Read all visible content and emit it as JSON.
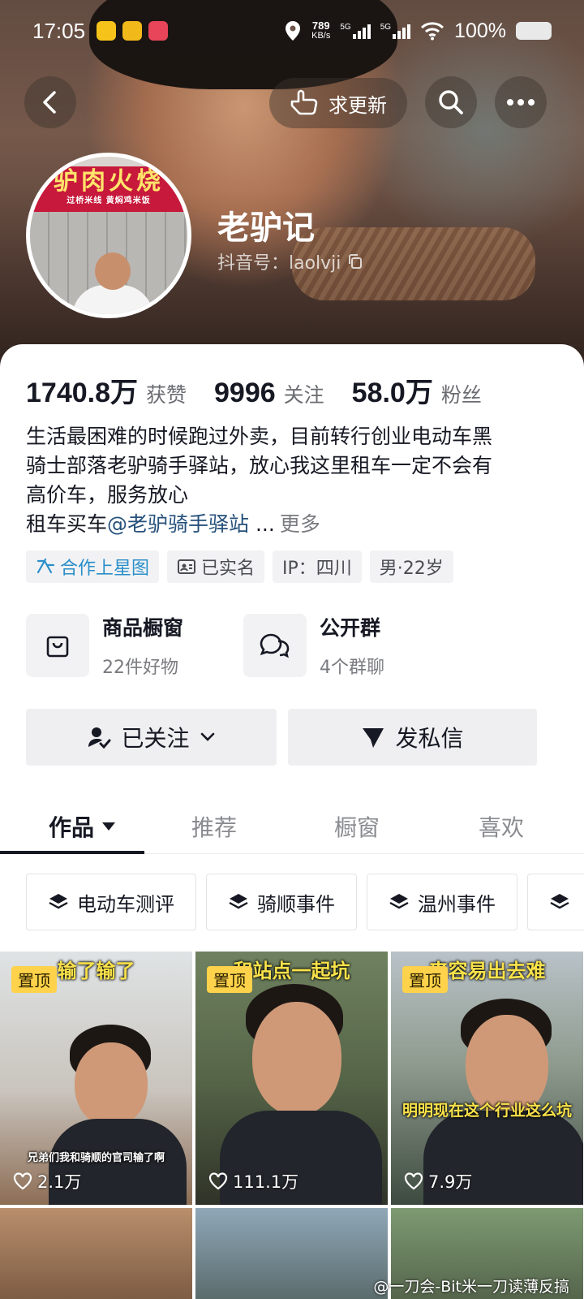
{
  "status_bar": {
    "time": "17:05",
    "net_speed_value": "789",
    "net_speed_unit": "KB/s",
    "sim1": "5G",
    "sim2": "5G",
    "battery": "100%"
  },
  "header": {
    "update_request_label": "求更新",
    "profile_name": "老驴记",
    "douyin_id": "抖音号：laolvji",
    "avatar_sign_text": "驴肉火烧",
    "avatar_sign_subtext": "过桥米线  黄焖鸡米饭"
  },
  "stats": {
    "likes_value": "1740.8万",
    "likes_label": "获赞",
    "following_value": "9996",
    "following_label": "关注",
    "followers_value": "58.0万",
    "followers_label": "粉丝"
  },
  "bio": {
    "line1": "生活最困难的时候跑过外卖，目前转行创业电动车黑",
    "line2": "骑士部落老驴骑手驿站，放心我这里租车一定不会有",
    "line3": "高价车，服务放心",
    "line4_prefix": "租车买车",
    "line4_mention": "@老驴骑手驿站",
    "line4_ellipsis": " ...",
    "more": "更多"
  },
  "tags": {
    "xingtu": "合作上星图",
    "verified": "已实名",
    "ip": "IP：四川",
    "gender_age": "男·22岁"
  },
  "services": {
    "shop_title": "商品橱窗",
    "shop_sub": "22件好物",
    "group_title": "公开群",
    "group_sub": "4个群聊"
  },
  "actions": {
    "followed": "已关注",
    "message": "发私信"
  },
  "tabs": {
    "works": "作品",
    "recommend": "推荐",
    "showcase": "橱窗",
    "likes": "喜欢"
  },
  "collections": [
    "电动车测评",
    "骑顺事件",
    "温州事件",
    ""
  ],
  "videos": [
    {
      "pin": "置顶",
      "caption": "输了输了",
      "subtitle": "兄弟们我和骑顺的官司输了啊",
      "likes": "2.1万"
    },
    {
      "pin": "置顶",
      "caption": "和站点一起坑",
      "subtitle": "",
      "likes": "111.1万"
    },
    {
      "pin": "置顶",
      "caption": "来容易出去难",
      "subtitle": "明明现在这个行业这么坑",
      "likes": "7.9万"
    }
  ],
  "watermark": "@一刀会-Bit米一刀读薄反搞",
  "colors": {
    "accent_blue": "#2a8fc9",
    "mention": "#25507a",
    "pin_yellow": "#fed24a"
  }
}
